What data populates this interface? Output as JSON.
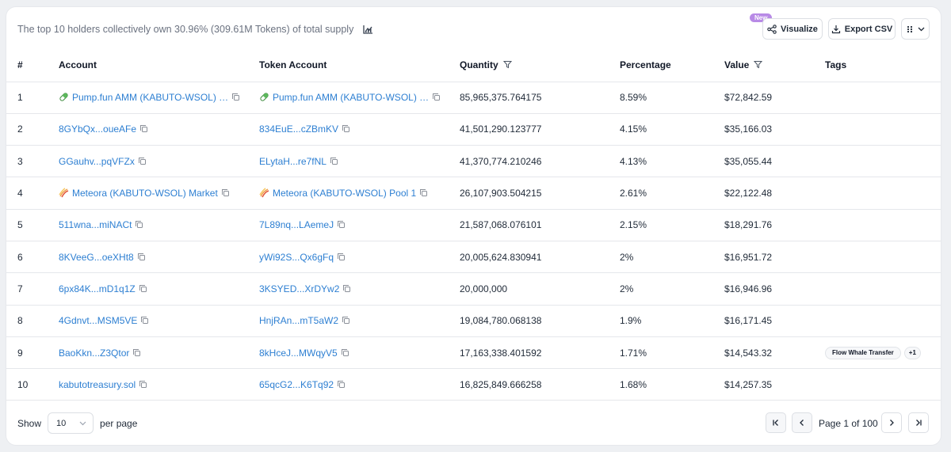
{
  "summary": {
    "text": "The top 10 holders collectively own 30.96% (309.61M Tokens) of total supply"
  },
  "toolbar": {
    "new_badge": "New",
    "visualize_label": "Visualize",
    "export_label": "Export CSV"
  },
  "table": {
    "headers": {
      "rank": "#",
      "account": "Account",
      "token_account": "Token Account",
      "quantity": "Quantity",
      "percentage": "Percentage",
      "value": "Value",
      "tags": "Tags"
    },
    "rows": [
      {
        "rank": "1",
        "account": "Pump.fun AMM (KABUTO-WSOL) …",
        "account_icon": "pill-icon",
        "token_account": "Pump.fun AMM (KABUTO-WSOL) …",
        "token_icon": "pill-icon",
        "quantity": "85,965,375.764175",
        "percentage": "8.59%",
        "value": "$72,842.59",
        "tags": []
      },
      {
        "rank": "2",
        "account": "8GYbQx...oueAFe",
        "token_account": "834EuE...cZBmKV",
        "quantity": "41,501,290.123777",
        "percentage": "4.15%",
        "value": "$35,166.03",
        "tags": []
      },
      {
        "rank": "3",
        "account": "GGauhv...pqVFZx",
        "token_account": "ELytaH...re7fNL",
        "quantity": "41,370,774.210246",
        "percentage": "4.13%",
        "value": "$35,055.44",
        "tags": []
      },
      {
        "rank": "4",
        "account": "Meteora (KABUTO-WSOL) Market",
        "account_icon": "meteora-icon",
        "token_account": "Meteora (KABUTO-WSOL) Pool 1",
        "token_icon": "meteora-icon",
        "quantity": "26,107,903.504215",
        "percentage": "2.61%",
        "value": "$22,122.48",
        "tags": []
      },
      {
        "rank": "5",
        "account": "511wna...miNACt",
        "token_account": "7L89nq...LAemeJ",
        "quantity": "21,587,068.076101",
        "percentage": "2.15%",
        "value": "$18,291.76",
        "tags": []
      },
      {
        "rank": "6",
        "account": "8KVeeG...oeXHt8",
        "token_account": "yWi92S...Qx6gFq",
        "quantity": "20,005,624.830941",
        "percentage": "2%",
        "value": "$16,951.72",
        "tags": []
      },
      {
        "rank": "7",
        "account": "6px84K...mD1q1Z",
        "token_account": "3KSYED...XrDYw2",
        "quantity": "20,000,000",
        "percentage": "2%",
        "value": "$16,946.96",
        "tags": []
      },
      {
        "rank": "8",
        "account": "4Gdnvt...MSM5VE",
        "token_account": "HnjRAn...mT5aW2",
        "quantity": "19,084,780.068138",
        "percentage": "1.9%",
        "value": "$16,171.45",
        "tags": []
      },
      {
        "rank": "9",
        "account": "BaoKkn...Z3Qtor",
        "token_account": "8kHceJ...MWqyV5",
        "quantity": "17,163,338.401592",
        "percentage": "1.71%",
        "value": "$14,543.32",
        "tags": [
          "Flow Whale Transfer",
          "+1"
        ]
      },
      {
        "rank": "10",
        "account": "kabutotreasury.sol",
        "token_account": "65qcG2...K6Tq92",
        "quantity": "16,825,849.666258",
        "percentage": "1.68%",
        "value": "$14,257.35",
        "tags": []
      }
    ]
  },
  "footer": {
    "show_label": "Show",
    "page_size": "10",
    "per_page_label": "per page",
    "page_label": "Page 1 of 100"
  },
  "colors": {
    "link": "#2d7fd2",
    "new_badge": "#b88ae6",
    "text": "#1f2937",
    "muted": "#6b7280"
  }
}
